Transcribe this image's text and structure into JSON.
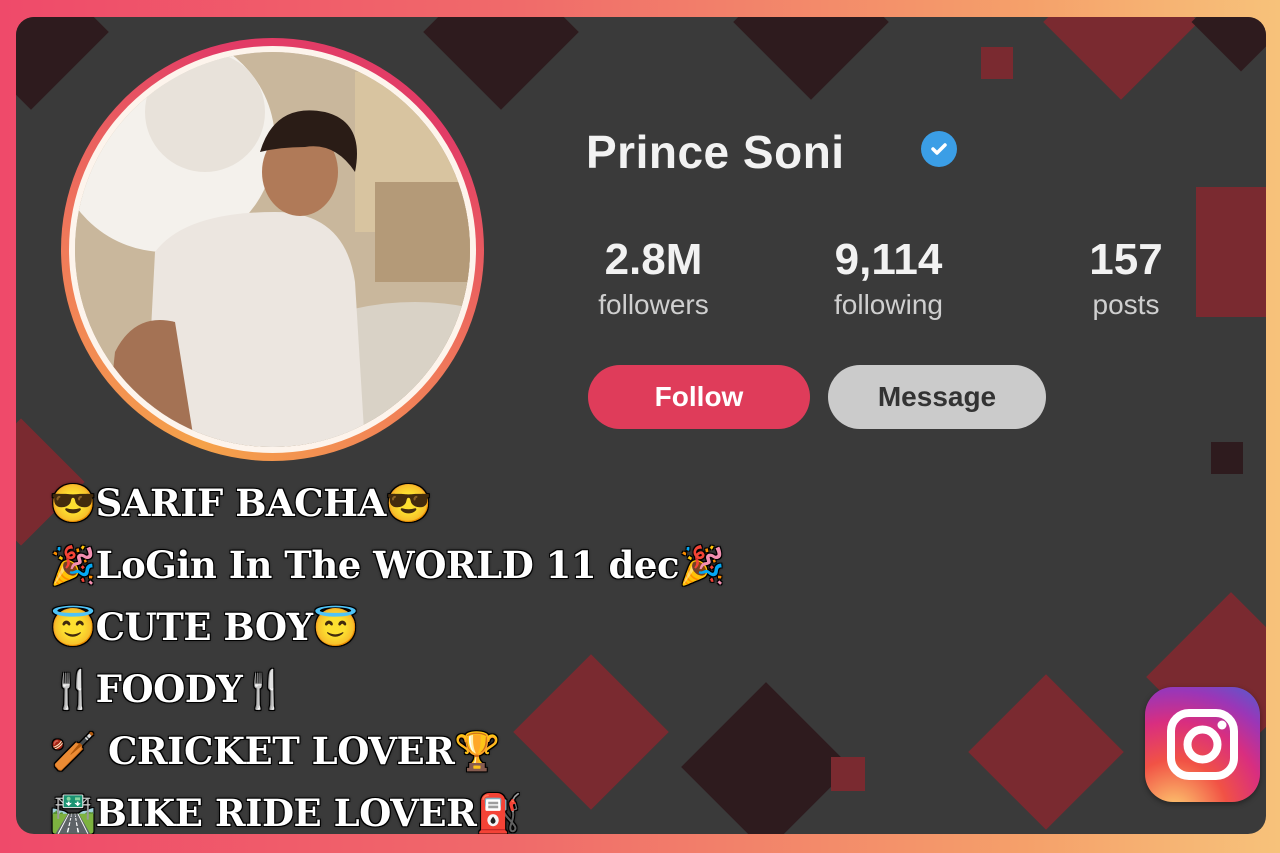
{
  "profile": {
    "name": "Prince Soni",
    "verified_icon": "verified-badge-icon",
    "stats": [
      {
        "value": "2.8M",
        "label": "followers"
      },
      {
        "value": "9,114",
        "label": "following"
      },
      {
        "value": "157",
        "label": "posts"
      }
    ],
    "follow_label": "Follow",
    "message_label": "Message"
  },
  "bio": {
    "lines": [
      "😎SARIF BACHA😎",
      "🎉LoGin In The WORLD 11 dec🎉",
      "😇CUTE BOY😇",
      "🍴FOODY🍴",
      "🏏 CRICKET LOVER🏆",
      "🛣️BIKE RIDE LOVER⛽"
    ]
  },
  "colors": {
    "follow_button": "#df3c5a",
    "message_button": "#cbcbcb",
    "verified": "#3b9ee6",
    "background": "#3a3a3a"
  },
  "icons": {
    "app_logo": "instagram-logo-icon",
    "avatar": "profile-photo"
  }
}
